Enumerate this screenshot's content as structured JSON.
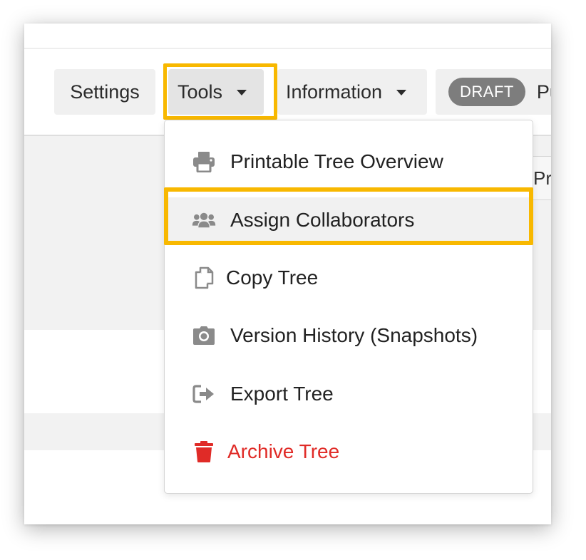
{
  "toolbar": {
    "settings_label": "Settings",
    "tools_label": "Tools",
    "information_label": "Information",
    "draft_badge": "DRAFT",
    "publish_label": "Pu"
  },
  "background": {
    "partial_label": "Pr"
  },
  "tools_menu": {
    "items": [
      {
        "label": "Printable Tree Overview",
        "icon": "printer-icon"
      },
      {
        "label": "Assign Collaborators",
        "icon": "users-icon"
      },
      {
        "label": "Copy Tree",
        "icon": "copy-icon"
      },
      {
        "label": "Version History (Snapshots)",
        "icon": "camera-icon"
      },
      {
        "label": "Export Tree",
        "icon": "export-icon"
      },
      {
        "label": "Archive Tree",
        "icon": "trash-icon"
      }
    ]
  },
  "colors": {
    "highlight": "#f8b800",
    "danger": "#e02b27",
    "icon_gray": "#8a8a8a",
    "badge_gray": "#7d7d7d"
  }
}
